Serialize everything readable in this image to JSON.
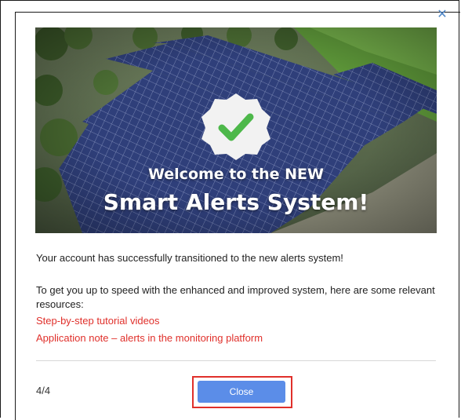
{
  "dialog": {
    "close_icon": "close-icon",
    "close_glyph": "✕"
  },
  "hero": {
    "title_line1": "Welcome to the NEW",
    "title_line2": "Smart Alerts System!",
    "badge_icon": "checkmark-icon"
  },
  "content": {
    "intro": "Your account has successfully transitioned to the new alerts system!",
    "resources_text": "To get you up to speed with the enhanced and improved system, here are some relevant resources:",
    "links": [
      {
        "label": "Step-by-step tutorial videos"
      },
      {
        "label": "Application note – alerts in the monitoring platform"
      }
    ]
  },
  "footer": {
    "page_indicator": "4/4",
    "close_label": "Close"
  },
  "colors": {
    "link": "#e0302b",
    "button": "#5b8de8",
    "close_icon": "#4f86c6",
    "highlight": "#e0302b"
  }
}
